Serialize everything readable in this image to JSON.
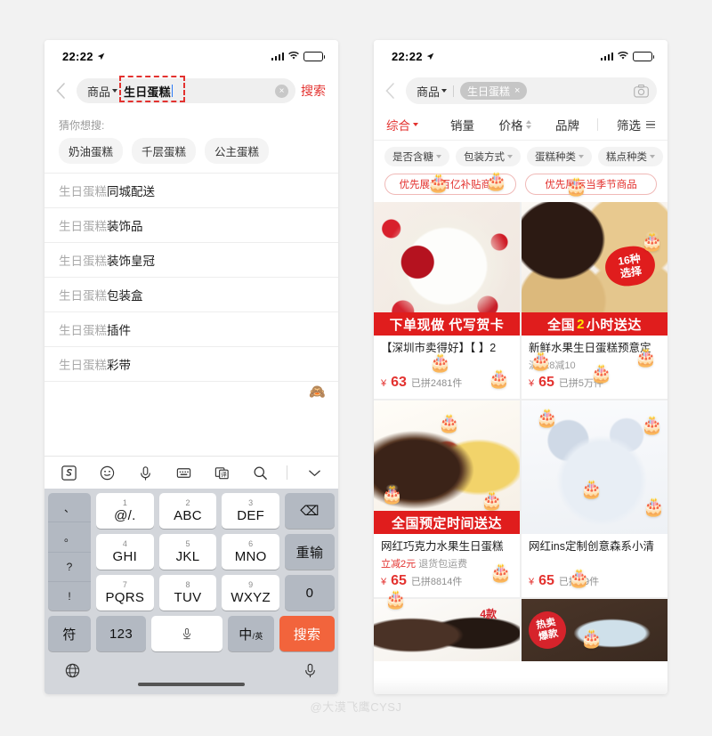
{
  "watermark": "@大漠飞鹰CYSJ",
  "left_phone": {
    "status": {
      "time": "22:22"
    },
    "search": {
      "category": "商品",
      "keyword": "生日蛋糕",
      "search_button": "搜索",
      "clear_label": "×"
    },
    "guess_label": "猜你想搜:",
    "chips": [
      "奶油蛋糕",
      "千层蛋糕",
      "公主蛋糕"
    ],
    "suggestions": [
      {
        "prefix": "生日蛋糕",
        "suffix": "同城配送"
      },
      {
        "prefix": "生日蛋糕",
        "suffix": "装饰品"
      },
      {
        "prefix": "生日蛋糕",
        "suffix": "装饰皇冠"
      },
      {
        "prefix": "生日蛋糕",
        "suffix": "包装盒"
      },
      {
        "prefix": "生日蛋糕",
        "suffix": "插件"
      },
      {
        "prefix": "生日蛋糕",
        "suffix": "彩带"
      }
    ],
    "keyboard": {
      "tools": [
        "sogou-logo-icon",
        "emoji-icon",
        "voice-icon",
        "keyboard-icon",
        "translate-icon",
        "search-icon",
        "collapse-icon"
      ],
      "punctuation": [
        "、",
        "。",
        "?",
        "!"
      ],
      "keys": [
        {
          "num": "1",
          "label": "@/."
        },
        {
          "num": "2",
          "label": "ABC"
        },
        {
          "num": "3",
          "label": "DEF"
        },
        {
          "num": "4",
          "label": "GHI"
        },
        {
          "num": "5",
          "label": "JKL"
        },
        {
          "num": "6",
          "label": "MNO"
        },
        {
          "num": "7",
          "label": "PQRS"
        },
        {
          "num": "8",
          "label": "TUV"
        },
        {
          "num": "9",
          "label": "WXYZ"
        }
      ],
      "backspace": "⌫",
      "redo": "重输",
      "zero": "0",
      "symbol": "符",
      "numeric": "123",
      "space": "space-mic-icon",
      "lang_main": "中",
      "lang_sub": "/英",
      "enter": "搜索",
      "globe": "globe-icon",
      "mic": "mic-icon"
    }
  },
  "right_phone": {
    "status": {
      "time": "22:22"
    },
    "search": {
      "category": "商品",
      "keyword_tag": "生日蛋糕",
      "tag_close": "×",
      "camera": "camera-icon"
    },
    "sort_tabs": [
      {
        "label": "综合",
        "active": true
      },
      {
        "label": "销量",
        "active": false
      },
      {
        "label": "价格",
        "active": false
      },
      {
        "label": "品牌",
        "active": false
      },
      {
        "label": "筛选",
        "active": false
      }
    ],
    "filter_chips": [
      "是否含糖",
      "包装方式",
      "蛋糕种类",
      "糕点种类"
    ],
    "promos": [
      "优先展示百亿补贴商品",
      "优先展示当季节商品"
    ],
    "products": [
      {
        "banner": "下单现做 代写贺卡",
        "banner_highlight": "",
        "title": "【深圳市卖得好】【  】2",
        "sub": "",
        "currency": "¥",
        "price": "63",
        "sold": "已拼2481件",
        "badge": ""
      },
      {
        "banner_pre": "全国",
        "banner_highlight": "2",
        "banner_post": "小时送达",
        "title": "新鲜水果生日蛋糕预意定",
        "sub": "满128减10",
        "currency": "¥",
        "price": "65",
        "sold": "已拼5万件",
        "badge_line1": "16种",
        "badge_line2": "选择"
      },
      {
        "banner": "全国预定时间送达",
        "title": "网红巧克力水果生日蛋糕",
        "sub_red": "立减2元",
        "sub": "退货包运费",
        "currency": "¥",
        "price": "65",
        "sold": "已拼8814件"
      },
      {
        "banner": "",
        "title": "网红ins定制创意森系小清",
        "sub": "",
        "currency": "¥",
        "price": "65",
        "sold": "已拼49件"
      },
      {
        "title": "",
        "badge": "4款"
      },
      {
        "title": "",
        "badge_line1": "热卖",
        "badge_line2": "爆款"
      }
    ]
  },
  "colors": {
    "accent_red": "#e3322f",
    "banner_red": "#e01d1d",
    "banner_yellow": "#ffe600",
    "orange_key": "#f2643c",
    "page_bg": "#f2f2f2"
  }
}
